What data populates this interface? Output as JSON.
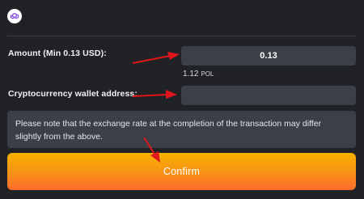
{
  "header": {
    "network_icon": "polygon-icon"
  },
  "form": {
    "amount_label": "Amount (Min 0.13 USD):",
    "amount_value": "0.13",
    "converted_amount": "1.12",
    "converted_unit": "POL",
    "wallet_label": "Cryptocurrency wallet address:",
    "wallet_value": ""
  },
  "note": {
    "text": "Please note that the exchange rate at the completion of the transaction may differ slightly from the above."
  },
  "confirm": {
    "label": "Confirm"
  },
  "colors": {
    "background": "#202226",
    "field": "#3b3f47",
    "button_top": "#f6b000",
    "button_bottom": "#ff6b2c",
    "arrow": "#e0161b",
    "icon": "#8247e5"
  }
}
